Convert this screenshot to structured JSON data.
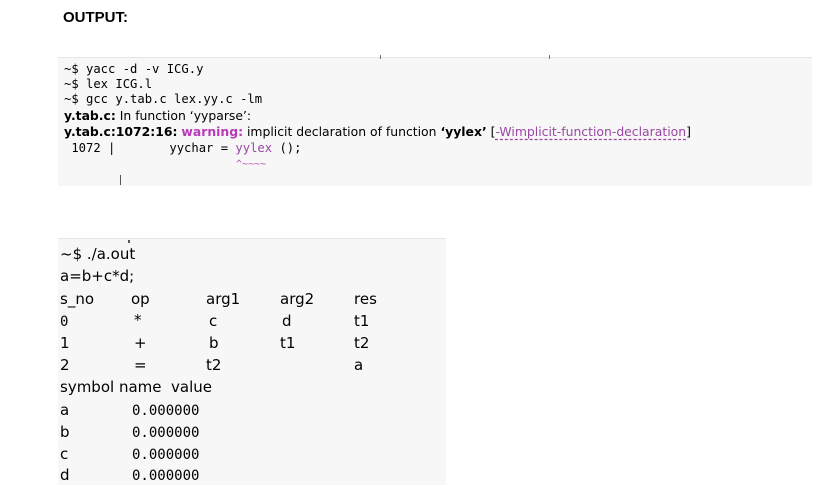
{
  "heading": "OUTPUT:",
  "terminal1": {
    "cmd1": "~$ yacc -d -v ICG.y",
    "cmd2": "~$ lex ICG.l",
    "cmd3": "~$ gcc y.tab.c lex.yy.c -lm",
    "line4_file": "y.tab.c:",
    "line4_rest": " In function ‘yyparse’:",
    "line5_loc": "y.tab.c:1072:16:",
    "line5_warn": "warning:",
    "line5_msg": " implicit declaration of function ",
    "line5_func": "‘yylex’",
    "line5_open": " [",
    "line5_flag": "-Wimplicit-function-declaration",
    "line5_close": "]",
    "line6_num": " 1072 |",
    "line6_pre": "yychar = ",
    "line6_ident": "yylex",
    "line6_post": " ();",
    "line7_squiggle": "^~~~~"
  },
  "terminal2": {
    "cmd": "~$ ./a.out",
    "input": "a=b+c*d;",
    "headers": [
      "s_no",
      "op",
      "arg1",
      "arg2",
      "res"
    ],
    "rows": [
      [
        "0",
        "*",
        "c",
        "d",
        "t1"
      ],
      [
        "1",
        "+",
        "b",
        "t1",
        "t2"
      ],
      [
        "2",
        "=",
        "t2",
        "",
        "a"
      ]
    ],
    "symbol_header": "symbol name  value",
    "symbols": [
      {
        "name": "a",
        "value": "0.000000"
      },
      {
        "name": "b",
        "value": "0.000000"
      },
      {
        "name": "c",
        "value": "0.000000"
      },
      {
        "name": "d",
        "value": "0.000000"
      }
    ]
  }
}
